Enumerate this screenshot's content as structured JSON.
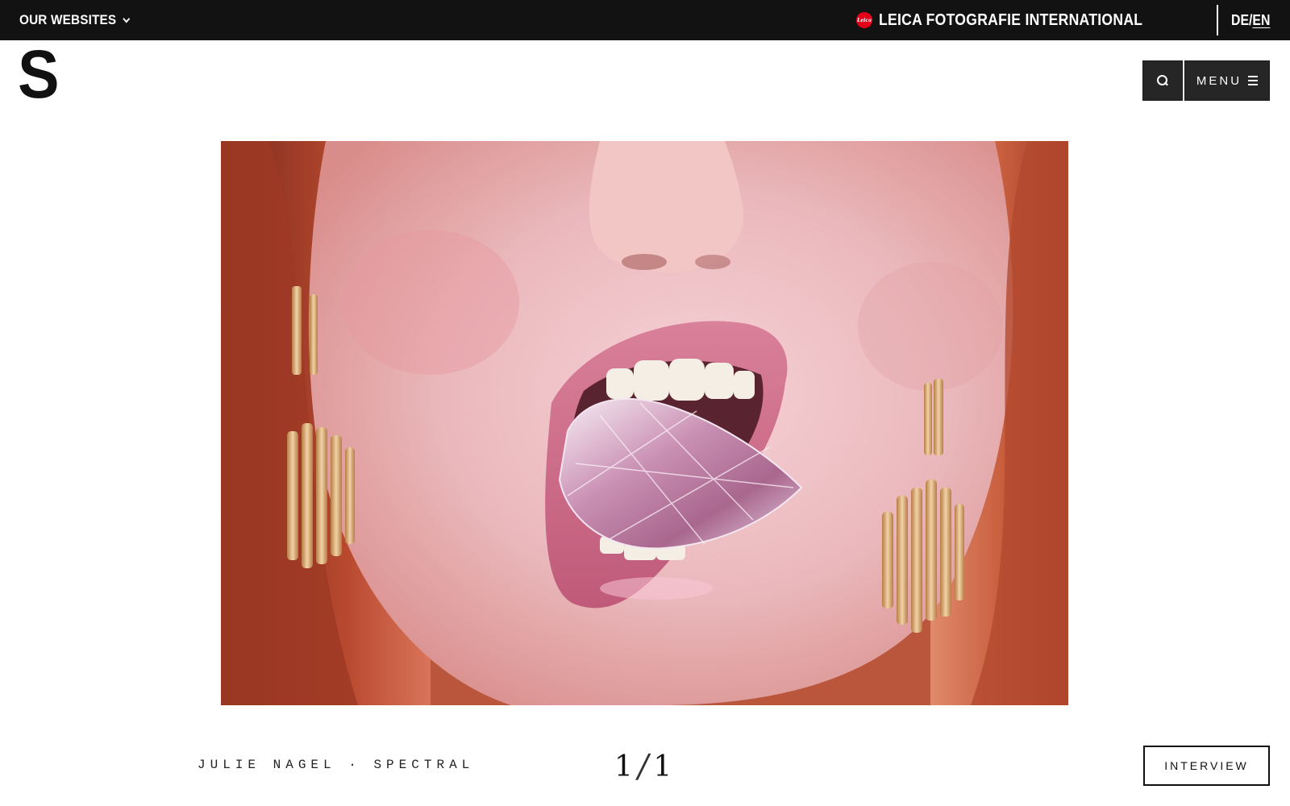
{
  "topbar": {
    "our_websites": "OUR WEBSITES",
    "brand_logo_text": "Leica",
    "brand_title": "LEICA FOTOGRAFIE INTERNATIONAL",
    "lang_de": "DE",
    "lang_separator": "/",
    "lang_en": "EN",
    "active_language": "EN"
  },
  "header": {
    "logo": "S",
    "menu_label": "MENU",
    "search_icon": "search-icon",
    "menu_icon": "hamburger-icon"
  },
  "photo": {
    "subject": "Close-up portrait: red-haired woman with pink lips holding a faceted pink crystal on her tongue, gold drop earrings"
  },
  "caption": {
    "photographer": "JULIE NAGEL",
    "separator": "·",
    "series": "SPECTRAL",
    "current": "1",
    "slash": "/",
    "total": "1",
    "interview_label": "INTERVIEW"
  },
  "colors": {
    "topbar_bg": "#121212",
    "button_bg": "#262626",
    "leica_red": "#e2001a",
    "background": "#ffffff"
  }
}
